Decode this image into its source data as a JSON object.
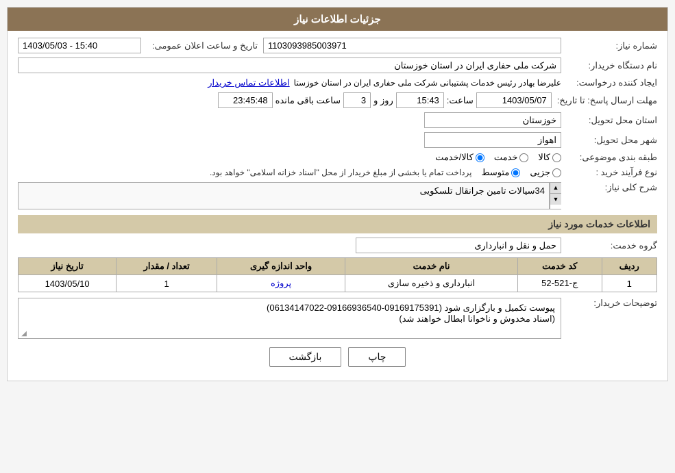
{
  "header": {
    "title": "جزئیات اطلاعات نیاز"
  },
  "fields": {
    "need_number_label": "شماره نیاز:",
    "need_number_value": "1103093985003971",
    "announcement_label": "تاریخ و ساعت اعلان عمومی:",
    "announcement_value": "1403/05/03 - 15:40",
    "buyer_name_label": "نام دستگاه خریدار:",
    "buyer_name_value": "شرکت ملی حفاری ایران در استان خوزستان",
    "creator_label": "ایجاد کننده درخواست:",
    "creator_value": "علیرضا بهادر رئیس خدمات پشتیبانی شرکت ملی حفاری ایران در استان خوزستا",
    "creator_link": "اطلاعات تماس خریدار",
    "reply_deadline_label": "مهلت ارسال پاسخ: تا تاریخ:",
    "reply_date": "1403/05/07",
    "reply_time_label": "ساعت:",
    "reply_time": "15:43",
    "reply_days_label": "روز و",
    "reply_days": "3",
    "reply_remaining_label": "ساعت باقی مانده",
    "reply_remaining": "23:45:48",
    "province_label": "استان محل تحویل:",
    "province_value": "خوزستان",
    "city_label": "شهر محل تحویل:",
    "city_value": "اهواز",
    "category_label": "طبقه بندی موضوعی:",
    "category_goods": "کالا",
    "category_service": "خدمت",
    "category_goods_service": "کالا/خدمت",
    "purchase_type_label": "نوع فرآیند خرید :",
    "purchase_type_1": "جزیی",
    "purchase_type_2": "متوسط",
    "purchase_note": "پرداخت تمام یا بخشی از مبلغ خریدار از محل \"اسناد خزانه اسلامی\" خواهد بود.",
    "description_label": "شرح کلی نیاز:",
    "description_value": "34سیالات تامین جرانقال تلسکویی",
    "services_section_label": "اطلاعات خدمات مورد نیاز",
    "service_group_label": "گروه خدمت:",
    "service_group_value": "حمل و نقل و انبارداری",
    "table_headers": [
      "ردیف",
      "کد خدمت",
      "نام خدمت",
      "واحد اندازه گیری",
      "تعداد / مقدار",
      "تاریخ نیاز"
    ],
    "table_rows": [
      {
        "row": "1",
        "code": "ج-521-52",
        "name": "انبارداری و ذخیره سازی",
        "unit": "پروژه",
        "quantity": "1",
        "date": "1403/05/10"
      }
    ],
    "buyer_notes_label": "توضیحات خریدار:",
    "buyer_notes_value": "پیوست تکمیل و بارگزاری شود (09169175391-09166936540-06134147022)\n(اسناد مخدوش و ناخوانا ابطال خواهند شد)"
  },
  "buttons": {
    "print_label": "چاپ",
    "back_label": "بازگشت"
  }
}
